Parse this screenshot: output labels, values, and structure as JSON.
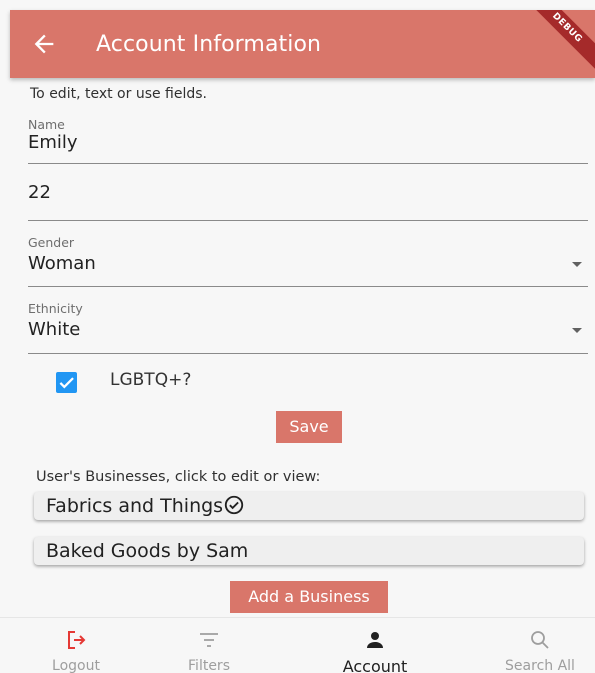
{
  "appbar": {
    "title": "Account Information",
    "debug_label": "DEBUG",
    "color": "#d9766a"
  },
  "hint": "To edit, text or use fields.",
  "fields": {
    "name": {
      "label": "Name",
      "value": "Emily"
    },
    "age": {
      "value": "22"
    },
    "gender": {
      "label": "Gender",
      "value": "Woman"
    },
    "ethnicity": {
      "label": "Ethnicity",
      "value": "White"
    }
  },
  "lgbtq": {
    "label": "LGBTQ+?",
    "checked": true
  },
  "save_label": "Save",
  "businesses": {
    "heading": "User's Businesses, click to edit or view:",
    "items": [
      {
        "name": "Fabrics and Things",
        "verified": true,
        "icon": "check-circle-icon"
      },
      {
        "name": "Baked Goods by Sam",
        "verified": false
      }
    ],
    "add_label": "Add a Business"
  },
  "nav": {
    "items": [
      {
        "label": "Logout",
        "icon": "logout-icon",
        "color": "#e53935"
      },
      {
        "label": "Filters",
        "icon": "filter-icon"
      },
      {
        "label": "Account",
        "icon": "person-icon",
        "active": true
      },
      {
        "label": "Search All",
        "icon": "search-icon"
      }
    ]
  }
}
